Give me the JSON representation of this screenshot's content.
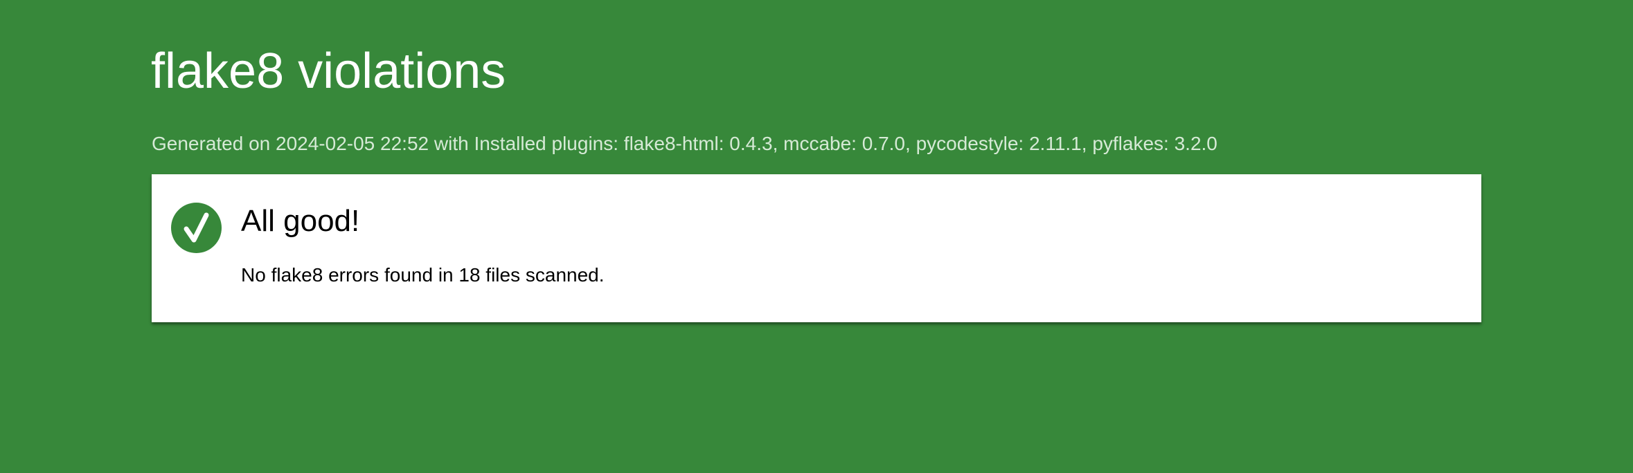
{
  "header": {
    "title": "flake8 violations",
    "generated_text": "Generated on 2024-02-05 22:52 with Installed plugins: flake8-html: 0.4.3, mccabe: 0.7.0, pycodestyle: 2.11.1, pyflakes: 3.2.0"
  },
  "result": {
    "icon": "check-icon",
    "heading": "All good!",
    "message": "No flake8 errors found in 18 files scanned."
  },
  "colors": {
    "background": "#37883a",
    "card": "#ffffff",
    "badge": "#37883a"
  }
}
